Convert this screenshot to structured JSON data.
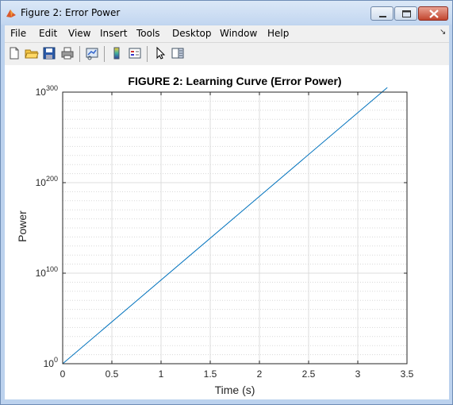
{
  "window": {
    "title": "Figure 2: Error Power",
    "controls": {
      "minimize": "minimize",
      "maximize": "maximize",
      "close": "close"
    }
  },
  "menu": {
    "items": [
      "File",
      "Edit",
      "View",
      "Insert",
      "Tools",
      "Desktop",
      "Window",
      "Help"
    ],
    "overflow_icon": "chevron-double-icon"
  },
  "toolbar": {
    "buttons": [
      {
        "name": "new-figure",
        "icon": "new-document-icon"
      },
      {
        "name": "open-file",
        "icon": "folder-open-icon"
      },
      {
        "name": "save-figure",
        "icon": "floppy-disk-icon"
      },
      {
        "name": "print-figure",
        "icon": "printer-icon"
      },
      {
        "name": "link-plot",
        "icon": "link-plot-icon"
      },
      {
        "name": "insert-colorbar",
        "icon": "colorbar-icon"
      },
      {
        "name": "insert-legend",
        "icon": "legend-icon"
      },
      {
        "name": "edit-plot",
        "icon": "cursor-arrow-icon"
      },
      {
        "name": "show-plot-tools",
        "icon": "plot-tools-icon"
      }
    ]
  },
  "chart_data": {
    "type": "line",
    "title": "FIGURE 2: Learning Curve (Error Power)",
    "xlabel": "Time (s)",
    "ylabel": "Power",
    "xlim": [
      0,
      3.5
    ],
    "ylim_log10": [
      0,
      300
    ],
    "yscale": "log",
    "grid": true,
    "minor_grid": true,
    "x_ticks": [
      "0",
      "0.5",
      "1",
      "1.5",
      "2",
      "2.5",
      "3",
      "3.5"
    ],
    "y_ticks": [
      {
        "base": "10",
        "exp": "0"
      },
      {
        "base": "10",
        "exp": "100"
      },
      {
        "base": "10",
        "exp": "200"
      },
      {
        "base": "10",
        "exp": "300"
      }
    ],
    "series": [
      {
        "color": "#0072bd",
        "x": [
          0,
          3.3
        ],
        "log10_y": [
          0,
          305
        ]
      }
    ]
  }
}
